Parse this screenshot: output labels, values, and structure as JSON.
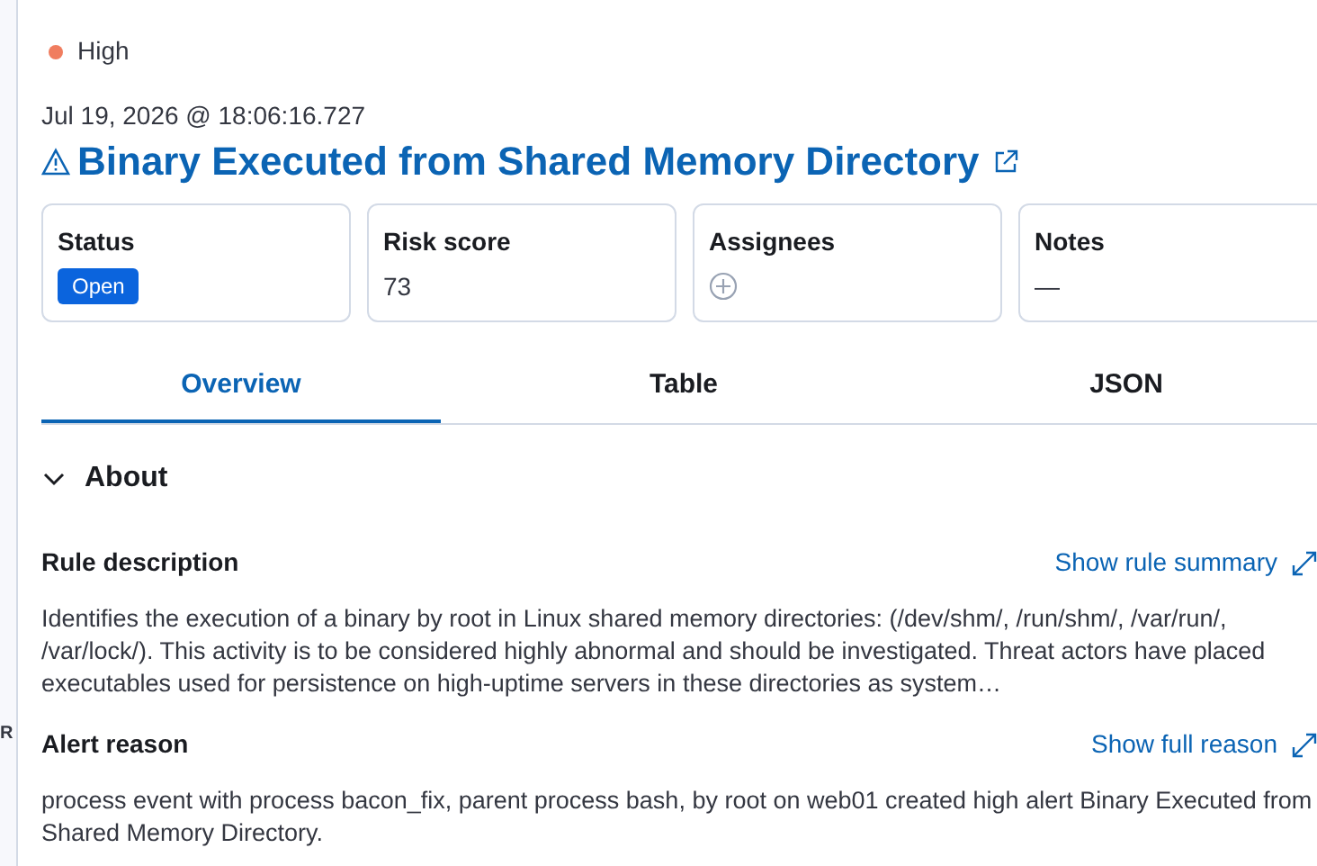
{
  "background_page": {
    "text": "R"
  },
  "severity": {
    "label": "High",
    "color": "#f07d5f"
  },
  "timestamp": "Jul 19, 2026 @ 18:06:16.727",
  "title": "Binary Executed from Shared Memory Directory",
  "cards": [
    {
      "label": "Status",
      "kind": "badge",
      "value": "Open"
    },
    {
      "label": "Risk score",
      "kind": "text",
      "value": "73"
    },
    {
      "label": "Assignees",
      "kind": "add"
    },
    {
      "label": "Notes",
      "kind": "text",
      "value": "—"
    }
  ],
  "tabs": [
    {
      "label": "Overview",
      "selected": true
    },
    {
      "label": "Table",
      "selected": false
    },
    {
      "label": "JSON",
      "selected": false
    }
  ],
  "section": {
    "title": "About",
    "expanded": true
  },
  "rule_description": {
    "label": "Rule description",
    "link": "Show rule summary",
    "text": "Identifies the execution of a binary by root in Linux shared memory directories: (/dev/shm/, /run/shm/, /var/run/, /var/lock/). This activity is to be considered highly abnormal and should be investigated. Threat actors have placed executables used for persistence on high-uptime servers in these directories as system…"
  },
  "alert_reason": {
    "label": "Alert reason",
    "link": "Show full reason",
    "text": "process event with process bacon_fix, parent process bash, by root on web01 created high alert Binary Executed from Shared Memory Directory."
  }
}
